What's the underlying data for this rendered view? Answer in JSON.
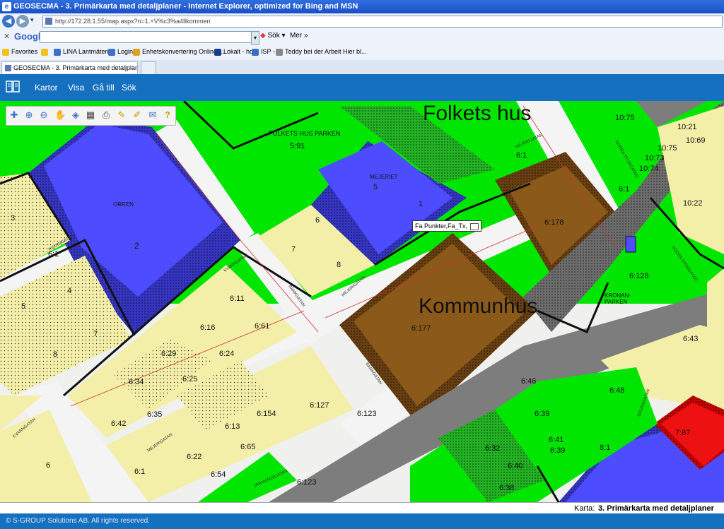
{
  "window": {
    "title": "GEOSECMA - 3. Primärkarta med detaljplaner - Internet Explorer, optimized for Bing and MSN"
  },
  "browser": {
    "address": "http://172.28.1.55/map.aspx?n=1.+V%c3%a4llkommen",
    "google_logo": "Google",
    "search_button": "Sök",
    "more_button": "Mer",
    "more_chevron": "»",
    "favorites": [
      "Favorites",
      "LINA Lantmäteriet",
      "Login",
      "Enhetskonvertering Online -...",
      "Lokalt - hd",
      "ISP -",
      "Teddy bei der Arbeit Hier bl..."
    ],
    "tab_title": "GEOSECMA - 3. Primärkarta med detaljplaner"
  },
  "app": {
    "menu": [
      "Kartor",
      "Visa",
      "Gå till",
      "Sök"
    ]
  },
  "toolbar": {
    "tools": [
      "zoom-in-icon",
      "zoom-in-magnifier-icon",
      "zoom-out-icon",
      "pan-hand-icon",
      "layers-icon",
      "table-icon",
      "print-icon",
      "measure-icon",
      "edit-icon",
      "mail-icon",
      "help-icon"
    ]
  },
  "map": {
    "labels": {
      "folkets_hus": "Folkets hus",
      "kommunhus": "Kommunhus",
      "folkets_hus_parken": "FOLKETS HUS PARKEN",
      "mejeriet": "MEJERIET",
      "orren": "ORREN",
      "kronanparken_1": "KRONAN-",
      "kronanparken_2": "PARKEN",
      "p_591": "5:91",
      "p_5": "5",
      "p_1": "1",
      "p_2": "2",
      "p_6": "6",
      "p_7": "7",
      "p_8": "8",
      "p_3": "3",
      "p_4": "4",
      "p_5b": "5",
      "p_7b": "7",
      "p_8b": "8",
      "p_6b": "6",
      "p_61": "6:1",
      "p_61b": "6:1",
      "p_61c": "6:1",
      "p_61d": "6:1",
      "p_6178": "6:178",
      "p_6177": "6:177",
      "p_6128": "6:128",
      "p_611": "6:11",
      "p_616": "6:16",
      "p_6167": "6:61",
      "p_629": "6:29",
      "p_624": "6:24",
      "p_625": "6:25",
      "p_634": "6:34",
      "p_635": "6:35",
      "p_642": "6:42",
      "p_6154": "6:154",
      "p_6127": "6:127",
      "p_6123a": "6:123",
      "p_6123b": "6:123",
      "p_613": "6:13",
      "p_665": "6:65",
      "p_622": "6:22",
      "p_654": "6:54",
      "p_646": "6:46",
      "p_639": "6:39",
      "p_632": "6:32",
      "p_641": "6:41",
      "p_640": "6:40",
      "p_638": "6:38",
      "p_643": "6:43",
      "p_648": "6:48",
      "p_81": "8:1",
      "p_787": "7:87",
      "p_1075": "10:75",
      "p_1075b": "10:75",
      "p_1073": "10:73",
      "p_1074": "10:74",
      "p_1069": "10:69",
      "p_1022": "10:22",
      "p_1021": "10:21",
      "p_639b": "6:39",
      "street_mejerigatan": "MEJERIGATAN",
      "street_mejerigatan2": "MEJERIGATAN",
      "street_kvarngatan": "KVARNGATAN",
      "street_bankgatan": "BANKGATAN",
      "street_bankgatan2": "BANKGATAN",
      "street_jarnvagsgatan": "JÄRNVÄGSGATAN",
      "street_brunsgatan": "BRUNSGATAN",
      "street_norra": "NORRA STORGATAN",
      "street_sodra": "SÖDRA STORGATAN",
      "street_kvarng2": "KVARNGATAN",
      "street_kvarng3": "KVARNGATAN"
    },
    "tooltip": "Fa Punkter,Fa_Tx,"
  },
  "status": {
    "map_label": "Karta:",
    "map_name": "3. Primärkarta med detaljplaner"
  },
  "footer": {
    "copyright": "© S-GROUP Solutions AB. All rights reserved."
  },
  "colors": {
    "header_blue": "#1670c0",
    "park_green": "#00e600",
    "building_blue": "#4d4dff",
    "residential_yellow": "#f3efa8",
    "municipal_brown": "#8b5a1a",
    "rail_gray": "#7d7d7d",
    "red_block": "#ee1111"
  }
}
